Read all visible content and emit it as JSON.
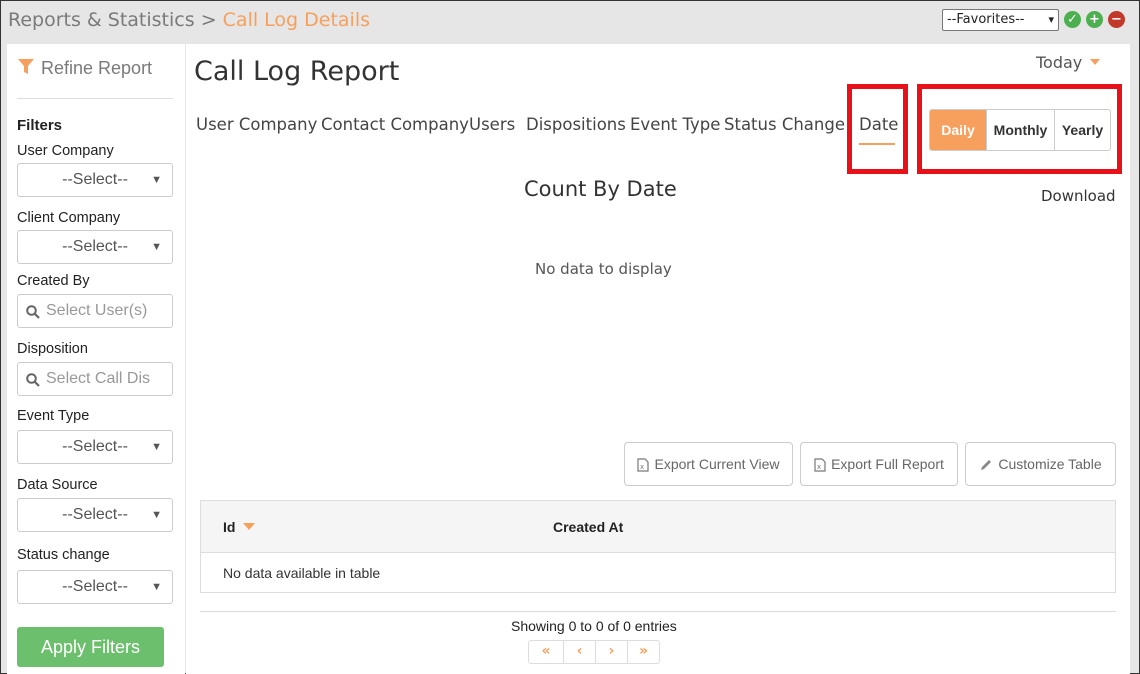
{
  "breadcrumb": {
    "parent": "Reports & Statistics",
    "separator": ">",
    "current": "Call Log Details"
  },
  "favorites": {
    "selected": "--Favorites--",
    "icons": [
      "check-icon",
      "add-icon",
      "remove-icon"
    ]
  },
  "sidebar": {
    "refine_label": "Refine Report",
    "filters_heading": "Filters",
    "filters": [
      {
        "label": "User Company",
        "type": "select",
        "value": "--Select--"
      },
      {
        "label": "Client Company",
        "type": "select",
        "value": "--Select--"
      },
      {
        "label": "Created By",
        "type": "search",
        "placeholder": "Select User(s)"
      },
      {
        "label": "Disposition",
        "type": "search",
        "placeholder": "Select Call Dis"
      },
      {
        "label": "Event Type",
        "type": "select",
        "value": "--Select--"
      },
      {
        "label": "Data Source",
        "type": "select",
        "value": "--Select--"
      },
      {
        "label": "Status change",
        "type": "select",
        "value": "--Select--"
      }
    ],
    "apply_label": "Apply Filters"
  },
  "main": {
    "title": "Call Log Report",
    "period": "Today",
    "tabs": [
      {
        "label": "User Company"
      },
      {
        "label": "Contact Company"
      },
      {
        "label": "Users"
      },
      {
        "label": "Dispositions"
      },
      {
        "label": "Event Type"
      },
      {
        "label": "Status Change"
      },
      {
        "label": "Date",
        "active": true
      }
    ],
    "granularity": {
      "options": [
        "Daily",
        "Monthly",
        "Yearly"
      ],
      "selected": "Daily"
    },
    "chart_title": "Count By Date",
    "download_label": "Download",
    "no_data": "No data to display",
    "buttons": {
      "export_current": "Export Current View",
      "export_full": "Export Full Report",
      "customize": "Customize Table"
    },
    "table": {
      "columns": [
        "Id",
        "Created At"
      ],
      "sorted_column": "Id",
      "empty_message": "No data available in table",
      "showing": "Showing 0 to 0 of 0 entries"
    },
    "pager": [
      "«",
      "‹",
      "›",
      "»"
    ]
  },
  "colors": {
    "accent": "#f7a05e",
    "apply_green": "#6cbf6c",
    "highlight_red": "#e8111a"
  }
}
